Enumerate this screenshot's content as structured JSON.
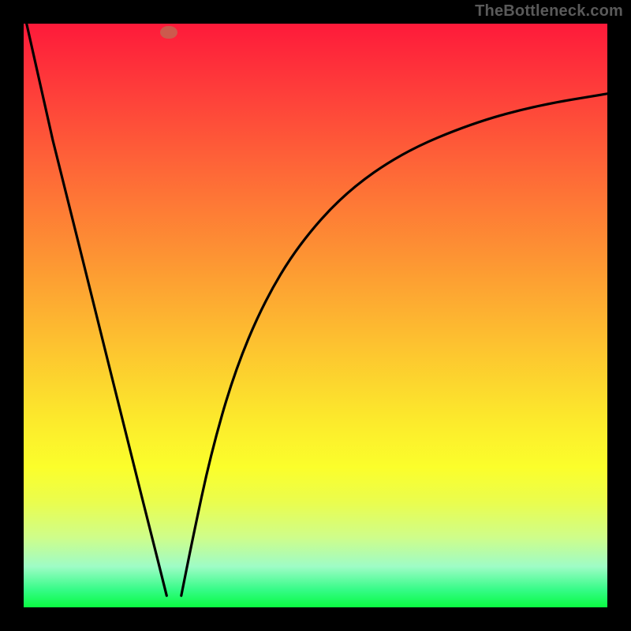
{
  "attribution": "TheBottleneck.com",
  "chart_data": {
    "type": "line",
    "title": "",
    "subtitle": "",
    "xlabel": "",
    "ylabel": "",
    "xlim": [
      0,
      1
    ],
    "ylim": [
      0,
      1
    ],
    "axes_visible": false,
    "grid": false,
    "background_gradient": [
      "#fe1a3a",
      "#fe6a37",
      "#fdbf30",
      "#fbfe2b",
      "#9efcc6",
      "#0afb42"
    ],
    "dot": {
      "x": 0.248,
      "y": 0.985,
      "color": "#cc5a4d"
    },
    "series": [
      {
        "name": "left-segment",
        "x": [
          0.005,
          0.05,
          0.1,
          0.15,
          0.2,
          0.23,
          0.245
        ],
        "y": [
          1.0,
          0.8,
          0.6,
          0.399,
          0.199,
          0.08,
          0.02
        ]
      },
      {
        "name": "right-segment",
        "x": [
          0.27,
          0.29,
          0.32,
          0.36,
          0.41,
          0.47,
          0.55,
          0.65,
          0.77,
          0.88,
          1.0
        ],
        "y": [
          0.02,
          0.12,
          0.26,
          0.4,
          0.52,
          0.62,
          0.71,
          0.78,
          0.83,
          0.86,
          0.88
        ]
      }
    ]
  }
}
